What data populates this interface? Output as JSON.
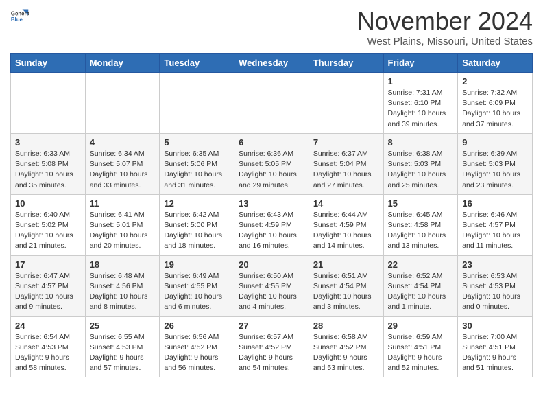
{
  "header": {
    "logo_general": "General",
    "logo_blue": "Blue",
    "month_title": "November 2024",
    "location": "West Plains, Missouri, United States"
  },
  "days_of_week": [
    "Sunday",
    "Monday",
    "Tuesday",
    "Wednesday",
    "Thursday",
    "Friday",
    "Saturday"
  ],
  "weeks": [
    [
      {
        "day": "",
        "info": ""
      },
      {
        "day": "",
        "info": ""
      },
      {
        "day": "",
        "info": ""
      },
      {
        "day": "",
        "info": ""
      },
      {
        "day": "",
        "info": ""
      },
      {
        "day": "1",
        "info": "Sunrise: 7:31 AM\nSunset: 6:10 PM\nDaylight: 10 hours and 39 minutes."
      },
      {
        "day": "2",
        "info": "Sunrise: 7:32 AM\nSunset: 6:09 PM\nDaylight: 10 hours and 37 minutes."
      }
    ],
    [
      {
        "day": "3",
        "info": "Sunrise: 6:33 AM\nSunset: 5:08 PM\nDaylight: 10 hours and 35 minutes."
      },
      {
        "day": "4",
        "info": "Sunrise: 6:34 AM\nSunset: 5:07 PM\nDaylight: 10 hours and 33 minutes."
      },
      {
        "day": "5",
        "info": "Sunrise: 6:35 AM\nSunset: 5:06 PM\nDaylight: 10 hours and 31 minutes."
      },
      {
        "day": "6",
        "info": "Sunrise: 6:36 AM\nSunset: 5:05 PM\nDaylight: 10 hours and 29 minutes."
      },
      {
        "day": "7",
        "info": "Sunrise: 6:37 AM\nSunset: 5:04 PM\nDaylight: 10 hours and 27 minutes."
      },
      {
        "day": "8",
        "info": "Sunrise: 6:38 AM\nSunset: 5:03 PM\nDaylight: 10 hours and 25 minutes."
      },
      {
        "day": "9",
        "info": "Sunrise: 6:39 AM\nSunset: 5:03 PM\nDaylight: 10 hours and 23 minutes."
      }
    ],
    [
      {
        "day": "10",
        "info": "Sunrise: 6:40 AM\nSunset: 5:02 PM\nDaylight: 10 hours and 21 minutes."
      },
      {
        "day": "11",
        "info": "Sunrise: 6:41 AM\nSunset: 5:01 PM\nDaylight: 10 hours and 20 minutes."
      },
      {
        "day": "12",
        "info": "Sunrise: 6:42 AM\nSunset: 5:00 PM\nDaylight: 10 hours and 18 minutes."
      },
      {
        "day": "13",
        "info": "Sunrise: 6:43 AM\nSunset: 4:59 PM\nDaylight: 10 hours and 16 minutes."
      },
      {
        "day": "14",
        "info": "Sunrise: 6:44 AM\nSunset: 4:59 PM\nDaylight: 10 hours and 14 minutes."
      },
      {
        "day": "15",
        "info": "Sunrise: 6:45 AM\nSunset: 4:58 PM\nDaylight: 10 hours and 13 minutes."
      },
      {
        "day": "16",
        "info": "Sunrise: 6:46 AM\nSunset: 4:57 PM\nDaylight: 10 hours and 11 minutes."
      }
    ],
    [
      {
        "day": "17",
        "info": "Sunrise: 6:47 AM\nSunset: 4:57 PM\nDaylight: 10 hours and 9 minutes."
      },
      {
        "day": "18",
        "info": "Sunrise: 6:48 AM\nSunset: 4:56 PM\nDaylight: 10 hours and 8 minutes."
      },
      {
        "day": "19",
        "info": "Sunrise: 6:49 AM\nSunset: 4:55 PM\nDaylight: 10 hours and 6 minutes."
      },
      {
        "day": "20",
        "info": "Sunrise: 6:50 AM\nSunset: 4:55 PM\nDaylight: 10 hours and 4 minutes."
      },
      {
        "day": "21",
        "info": "Sunrise: 6:51 AM\nSunset: 4:54 PM\nDaylight: 10 hours and 3 minutes."
      },
      {
        "day": "22",
        "info": "Sunrise: 6:52 AM\nSunset: 4:54 PM\nDaylight: 10 hours and 1 minute."
      },
      {
        "day": "23",
        "info": "Sunrise: 6:53 AM\nSunset: 4:53 PM\nDaylight: 10 hours and 0 minutes."
      }
    ],
    [
      {
        "day": "24",
        "info": "Sunrise: 6:54 AM\nSunset: 4:53 PM\nDaylight: 9 hours and 58 minutes."
      },
      {
        "day": "25",
        "info": "Sunrise: 6:55 AM\nSunset: 4:53 PM\nDaylight: 9 hours and 57 minutes."
      },
      {
        "day": "26",
        "info": "Sunrise: 6:56 AM\nSunset: 4:52 PM\nDaylight: 9 hours and 56 minutes."
      },
      {
        "day": "27",
        "info": "Sunrise: 6:57 AM\nSunset: 4:52 PM\nDaylight: 9 hours and 54 minutes."
      },
      {
        "day": "28",
        "info": "Sunrise: 6:58 AM\nSunset: 4:52 PM\nDaylight: 9 hours and 53 minutes."
      },
      {
        "day": "29",
        "info": "Sunrise: 6:59 AM\nSunset: 4:51 PM\nDaylight: 9 hours and 52 minutes."
      },
      {
        "day": "30",
        "info": "Sunrise: 7:00 AM\nSunset: 4:51 PM\nDaylight: 9 hours and 51 minutes."
      }
    ]
  ]
}
